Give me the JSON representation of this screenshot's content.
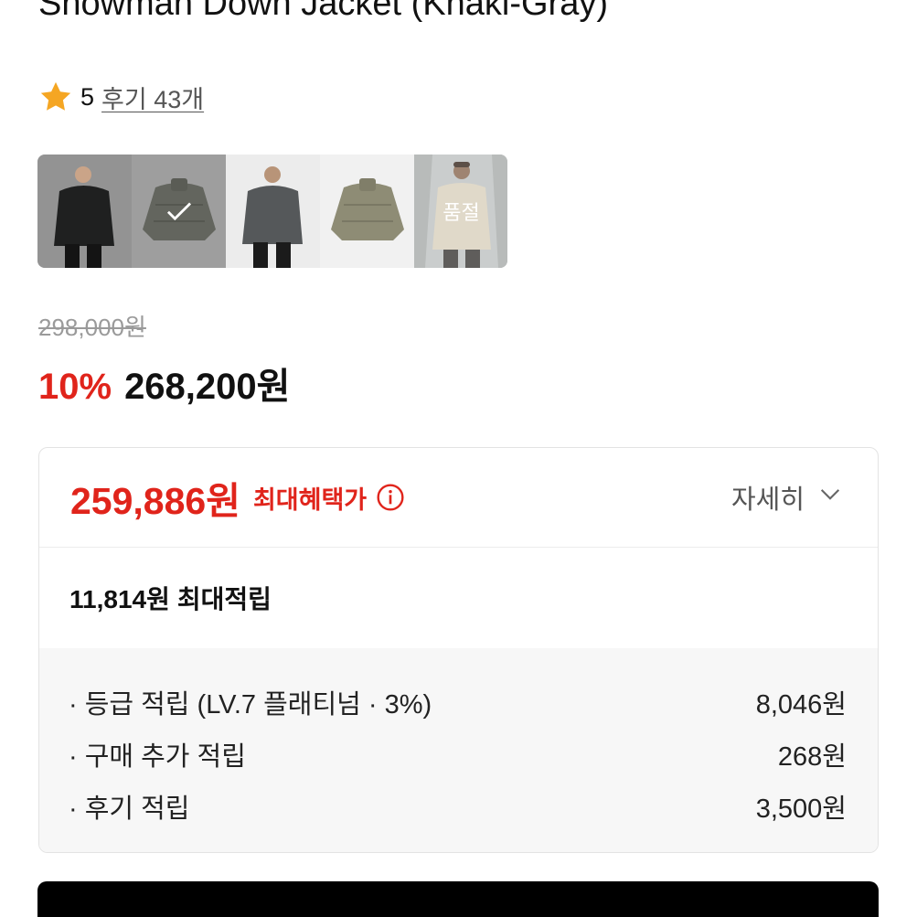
{
  "product": {
    "title": "Snowman Down Jacket (Khaki-Gray)",
    "rating": "5",
    "review_link": "후기 43개"
  },
  "thumbnails": [
    {
      "name": "thumb-black-model",
      "selected": false,
      "soldout": false
    },
    {
      "name": "thumb-khaki-flat",
      "selected": true,
      "soldout": false
    },
    {
      "name": "thumb-gray-model",
      "selected": false,
      "soldout": false
    },
    {
      "name": "thumb-olive-flat",
      "selected": false,
      "soldout": false
    },
    {
      "name": "thumb-beige-model",
      "selected": false,
      "soldout": true,
      "soldout_label": "품절"
    }
  ],
  "price": {
    "original": "298,000원",
    "discount": "10%",
    "sale": "268,200원"
  },
  "benefit": {
    "max_price": "259,886원",
    "max_label": "최대혜택가",
    "detail_label": "자세히",
    "points_amount": "11,814원",
    "points_label": "최대적립",
    "items": [
      {
        "label": "· 등급 적립 (LV.7 플래티넘 · 3%)",
        "value": "8,046원"
      },
      {
        "label": "· 구매 추가 적립",
        "value": "268원"
      },
      {
        "label": "· 후기 적립",
        "value": "3,500원"
      }
    ]
  },
  "colors": {
    "accent_red": "#e0241b",
    "star": "#f5a623",
    "buy_bar": "#000000"
  },
  "icons": {
    "rating": "star-icon",
    "info": "info-circle-icon",
    "detail": "chevron-down-icon",
    "selected": "check-icon"
  }
}
